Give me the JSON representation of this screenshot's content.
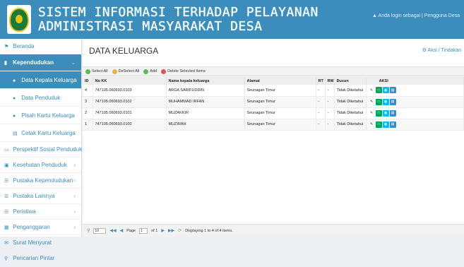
{
  "header": {
    "title_line1": "SISTEM INFORMASI TERHADAP PELAYANAN",
    "title_line2": "ADMINISTRASI MASYARAKAT DESA",
    "user_text": "Anda login sebagai | Pengguna Desa"
  },
  "sidebar": {
    "items": [
      {
        "label": "Beranda",
        "icon": "home-icon"
      },
      {
        "label": "Kependudukan",
        "icon": "book-icon"
      },
      {
        "label": "Data Kepala Keluarga",
        "icon": "user-icon"
      },
      {
        "label": "Data Penduduk",
        "icon": "users-icon"
      },
      {
        "label": "Pisah Kartu Keluarga",
        "icon": "users-icon"
      },
      {
        "label": "Cetak Kartu Keluarga",
        "icon": "print-icon"
      },
      {
        "label": "Perspektif Sosial Penduduk",
        "icon": "monitor-icon"
      },
      {
        "label": "Kesehatan Penduduk",
        "icon": "medkit-icon"
      },
      {
        "label": "Pustaka Kependudukan",
        "icon": "list-icon"
      },
      {
        "label": "Pustaka Lainnya",
        "icon": "list-icon"
      },
      {
        "label": "Peristiwa",
        "icon": "list-icon"
      },
      {
        "label": "Penganggaran",
        "icon": "money-icon"
      },
      {
        "label": "Surat Menyurat",
        "icon": "mail-icon"
      },
      {
        "label": "Pencarian Pintar",
        "icon": "search-icon"
      }
    ]
  },
  "main": {
    "title": "DATA KELUARGA",
    "actions_link": "Aksi / Tindakan",
    "toolbar": {
      "select_all": "Select All",
      "deselect_all": "DeSelect All",
      "add": "Add",
      "delete_selected": "Delete Selected Items"
    },
    "columns": [
      "ID",
      "No KK",
      "Nama kepala keluarga",
      "Alamat",
      "RT",
      "RW",
      "Dusun",
      "AKSI"
    ],
    "rows": [
      {
        "id": "4",
        "nokk": "747105.060693.0103",
        "nama": "ARGA SARIFUDDIN",
        "alamat": "Seunagan Timur",
        "rt": "-",
        "rw": "-",
        "dusun": "Tidak Diketahui"
      },
      {
        "id": "3",
        "nokk": "747105.060693.0102",
        "nama": "MUHAMMAD IRFAN",
        "alamat": "Seunagan Timur",
        "rt": "-",
        "rw": "-",
        "dusun": "Tidak Diketahui"
      },
      {
        "id": "2",
        "nokk": "747105.060693.0101",
        "nama": "MUZAKKIR",
        "alamat": "Seunagan Timur",
        "rt": "-",
        "rw": "-",
        "dusun": "Tidak Diketahui"
      },
      {
        "id": "1",
        "nokk": "747105.060693.0100",
        "nama": "MUZIRAH",
        "alamat": "Seunagan Timur",
        "rt": "-",
        "rw": "-",
        "dusun": "Tidak Diketahui"
      }
    ],
    "pager": {
      "page_size": "10",
      "page_label": "Page",
      "page_value": "1",
      "of_label": "of 1",
      "status": "Displaying 1 to 4 of 4 items."
    }
  },
  "colors": {
    "primary": "#3c8dbc",
    "sidebar_bg": "#ffffff",
    "content_bg": "#ffffff"
  }
}
